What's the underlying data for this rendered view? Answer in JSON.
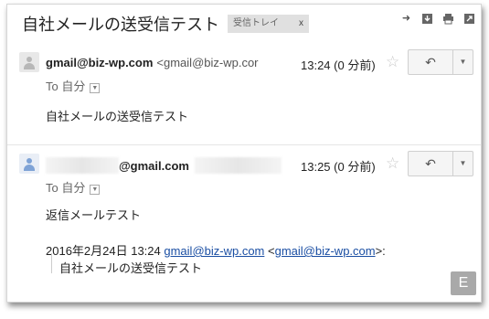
{
  "thread": {
    "subject": "自社メールの送受信テスト",
    "label": "受信トレイ",
    "label_close": "x"
  },
  "toolbar_icons": [
    "forward-all-icon",
    "download-icon",
    "print-icon",
    "new-window-icon"
  ],
  "messages": [
    {
      "from_name": "gmail@biz-wp.com",
      "from_addr": "<gmail@biz-wp.cor",
      "time": "13:24 (0 分前)",
      "to_label": "To 自分",
      "body": "自社メールの送受信テスト"
    },
    {
      "from_name": "@gmail.com",
      "time": "13:25 (0 分前)",
      "to_label": "To 自分",
      "body": "返信メールテスト",
      "quote_header_prefix": "2016年2月24日 13:24 ",
      "quote_link1": "gmail@biz-wp.com",
      "quote_mid": " <",
      "quote_link2": "gmail@biz-wp.com",
      "quote_suffix": ">:",
      "quote_body": "自社メールの送受信テスト"
    }
  ],
  "badge": "E",
  "colors": {
    "link": "#1a4ea3",
    "chip_bg": "#e0e0e0",
    "avatar_blue": "#7fa3d6"
  }
}
